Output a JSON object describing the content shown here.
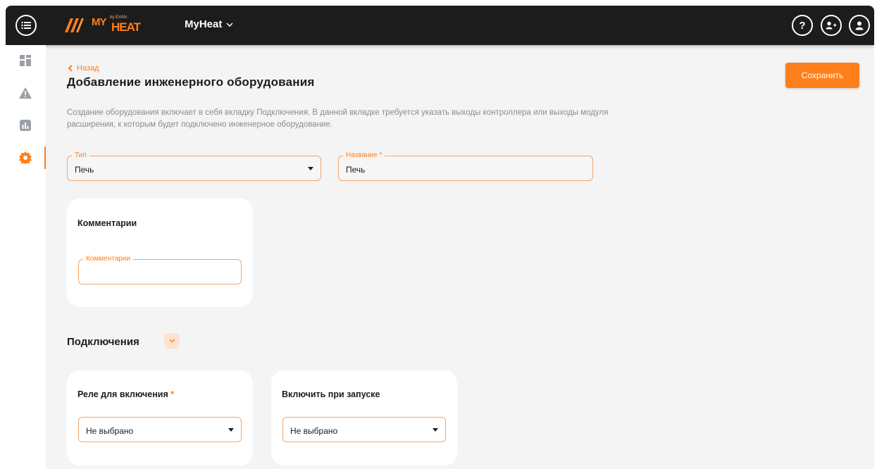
{
  "header": {
    "menu_icon": "menu-icon",
    "logo_text": "MY",
    "logo_sub": "by EVAN",
    "logo_word": "HEAT",
    "app_name": "MyHeat",
    "help_icon": "help-icon",
    "add_user_icon": "add-user-icon",
    "profile_icon": "profile-icon"
  },
  "sidebar": {
    "items": [
      {
        "icon": "dashboard-icon"
      },
      {
        "icon": "warning-icon"
      },
      {
        "icon": "chart-icon"
      },
      {
        "icon": "gear-icon",
        "active": true
      }
    ]
  },
  "page": {
    "back_label": "Назад",
    "title": "Добавление инженерного оборудования",
    "save_label": "Сохранить",
    "description": "Создание оборудования включает в себя вкладку Подключения. В данной вкладке требуется указать выходы контроллера или выходы модуля расширения, к которым будет подключено инженерное оборудование."
  },
  "form": {
    "type_label": "Тип",
    "type_value": "Печь",
    "name_label": "Название",
    "name_required": "*",
    "name_value": "Печь"
  },
  "comments_card": {
    "title": "Комментарии",
    "field_label": "Комментарии",
    "field_value": ""
  },
  "connections": {
    "title": "Подключения",
    "relay_card": {
      "title": "Реле для включения",
      "required": "*",
      "value": "Не выбрано"
    },
    "startup_card": {
      "title": "Включить при запуске",
      "value": "Не выбрано"
    }
  },
  "colors": {
    "accent": "#ff7f1a",
    "topbar": "#1c1c1c",
    "background": "#f4f4f5"
  }
}
